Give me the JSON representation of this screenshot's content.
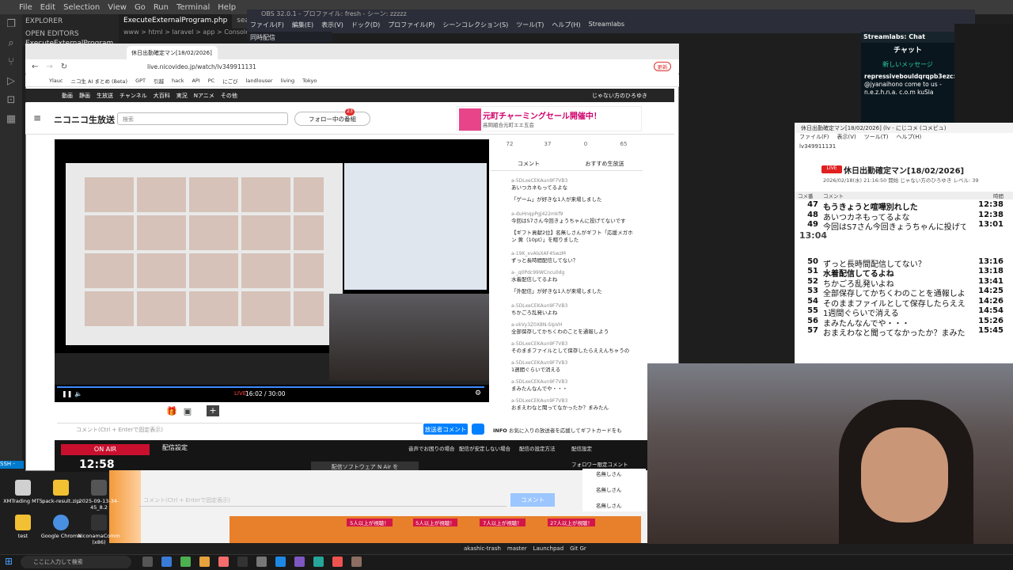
{
  "vscode": {
    "menu": [
      "File",
      "Edit",
      "Selection",
      "View",
      "Go",
      "Run",
      "Terminal",
      "Help"
    ],
    "explorer_label": "EXPLORER",
    "open_editors_label": "OPEN EDITORS",
    "open_file": "ExecuteExternalProgram.php",
    "tabs": [
      "ExecuteExternalProgram.php",
      "search_new"
    ],
    "breadcrumb": "www > html > laravel > app > Console > Commands",
    "status_left": "SSH -"
  },
  "obs": {
    "title": "OBS 32.0.1 - プロファイル: fresh - シーン: zzzzz",
    "menu": [
      "ファイル(F)",
      "編集(E)",
      "表示(V)",
      "ドック(D)",
      "プロファイル(P)",
      "シーンコレクション(S)",
      "ツール(T)",
      "ヘルプ(H)",
      "Streamlabs"
    ],
    "dock_tab": "同時配信"
  },
  "streamlabs": {
    "head": "Streamlabs: Chat",
    "chat_title": "チャット",
    "new_message": "新しいメッセージ",
    "user": "repressivebouldqrqpb3ezc:",
    "message": "@jyanaihono come to us - n.e.z.h.n.a. c.o.m kuSla"
  },
  "viewer": {
    "title": "休日出勤確定マン[18/02/2026] (lv - にじコメ  (コメビュ)",
    "menu": [
      "ファイル(F)",
      "表示(V)",
      "ツール(T)",
      "ヘルプ(H)"
    ],
    "url": "lv349911131",
    "live_badge": "LIVE",
    "program_title": "休日出勤確定マン[18/02/2026]",
    "program_sub": "2026/02/18(水) 21:16:50 開始  じゃない方のひろゆき  レベル: 39",
    "columns": [
      "コメ番",
      "コメント",
      "時間"
    ],
    "rows": [
      {
        "num": "47",
        "text": "もうきょうと喧嘩別れした",
        "time": "12:38",
        "style": "hi"
      },
      {
        "num": "48",
        "text": "あいつカネもってるよな",
        "time": "12:38",
        "style": ""
      },
      {
        "num": "49",
        "text": "今回はS7さん今回きょうちゃんに投げてない",
        "time": "13:01",
        "style": ""
      },
      {
        "num": "",
        "text": "【ギフト貢献2位】名無しさんがギフト「応援メガホン 黄（10pt）」を贈りました",
        "time": "13:04",
        "style": "gift"
      },
      {
        "num": "50",
        "text": "ずっと長時間配信してない？",
        "time": "13:16",
        "style": ""
      },
      {
        "num": "51",
        "text": "水着配信してるよね",
        "time": "13:18",
        "style": "hi"
      },
      {
        "num": "52",
        "text": "ちかごろ乱発いよね",
        "time": "13:41",
        "style": ""
      },
      {
        "num": "53",
        "text": "全部保存してかちくわのことを通報しよう",
        "time": "14:25",
        "style": ""
      },
      {
        "num": "54",
        "text": "そのままファイルとして保存したらええんちゃうの",
        "time": "14:26",
        "style": ""
      },
      {
        "num": "55",
        "text": "1週間ぐらいで消える",
        "time": "14:54",
        "style": ""
      },
      {
        "num": "56",
        "text": "まみたんなんでや・・・",
        "time": "15:26",
        "style": ""
      },
      {
        "num": "57",
        "text": "おまえわなと聞ってなかったか？まみたん",
        "time": "15:45",
        "style": ""
      }
    ]
  },
  "browser": {
    "tab_title": "休日出勤確定マン[18/02/2026]",
    "url": "live.nicovideo.jp/watch/lv349911131",
    "bookmarks": [
      "Ylauc",
      "ニコ生 AI まとめ (Beta)",
      "GPT",
      "引越",
      "hack",
      "API",
      "PC",
      "にごび",
      "landlouser",
      "living",
      "Tokyo"
    ],
    "update_btn": "更新"
  },
  "nico": {
    "topnav": [
      "動画",
      "静画",
      "生放送",
      "チャンネル",
      "大百科",
      "実況",
      "Nアニメ",
      "その他"
    ],
    "user": "じゃない方のひろゆき",
    "logo": "ニコニコ生放送",
    "search_placeholder": "検索",
    "follow_button": "フォロー中の番組",
    "follow_count": "23",
    "ad_title": "元町チャーミングセール開催中！",
    "ad_sub": "高岡組合元町エエ五会",
    "live_label": "LIVE",
    "time": "16:02 / 30:00",
    "stats": [
      "72",
      "37",
      "0",
      "65"
    ],
    "side_tabs": [
      "コメント",
      "おすすめ生放送"
    ],
    "comments": [
      {
        "uid": "a-5DLxeCEKAun9F7VB3",
        "text": "あいつカネもってるよな"
      },
      {
        "uid": "",
        "text": "「ゲーム」が好きな1人が来場しました"
      },
      {
        "uid": "a-duHnqpPgJ422mkf9",
        "text": "今回はS7さん今回きょうちゃんに投げてないです"
      },
      {
        "uid": "",
        "text": "【ギフト貢献2位】名無しさんがギフト「応援メガホン 黄（10pt）」を贈りました"
      },
      {
        "uid": "a-19K_xvAlsXAF4SwzM",
        "text": "ずっと長時間配信してない？"
      },
      {
        "uid": "a-_q0Pdc99WCncu0dg",
        "text": "水着配信してるよね"
      },
      {
        "uid": "",
        "text": "「外配信」が好きな1人が来場しました"
      },
      {
        "uid": "a-5DLxeCEKAun9F7VB3",
        "text": "ちかごろ乱発いよね"
      },
      {
        "uid": "a-vkVy3Z0X8N-SIpVH",
        "text": "全部保存してかちくわのことを通報しよう"
      },
      {
        "uid": "a-5DLxeCEKAun9F7VB3",
        "text": "そのままファイルとして保存したらええんちゃうの"
      },
      {
        "uid": "a-5DLxeCEKAun9F7VB3",
        "text": "1週間ぐらいで消える"
      },
      {
        "uid": "a-5DLxeCEKAun9F7VB3",
        "text": "まみたんなんでや・・・"
      },
      {
        "uid": "a-5DLxeCEKAun9F7VB3",
        "text": "おまえわなと聞ってなかったか？まみたん"
      }
    ],
    "comment_placeholder": "コメント(Ctrl + Enterで固定表示)",
    "comment_button": "放送者コメント",
    "info_label": "INFO",
    "info_text": "お気に入りの放送者を応援してギフトカードをも",
    "on_air": "ON AIR",
    "on_air_time": "12:58",
    "broadcast_settings": "配信設定",
    "bc_links": [
      "音声でお困りの場合",
      "配信が安定しない場合",
      "配信の設定方法"
    ],
    "bc_side_settings": "配信設定",
    "bc_follow_only": "フォロワー限定コメント",
    "software": "配信ソフトウェア N Air を"
  },
  "lower": {
    "comment_placeholder": "コメント(Ctrl + Enterで固定表示)",
    "comment_button": "コメント",
    "badges": [
      "5人以上が視聴！",
      "5人以上が視聴！",
      "7人以上が視聴！",
      "27人以上が視聴！"
    ],
    "names": [
      "名無しさん",
      "名無しさん",
      "名無しさん"
    ]
  },
  "desktop_icons": [
    {
      "label": "XMTrading MT5",
      "color": "#d0d0d0"
    },
    {
      "label": "pack-result.zip",
      "color": "#f2c033"
    },
    {
      "label": "2025-09-13-34-45_8.2",
      "color": "#555"
    },
    {
      "label": "test",
      "color": "#f2c033"
    },
    {
      "label": "Google Chrome",
      "color": "#4a90e2"
    },
    {
      "label": "NiconamaComm (x86)",
      "color": "#333"
    }
  ],
  "taskbar": {
    "search_placeholder": "ここに入力して検索",
    "git": [
      "akashic-trash",
      "master",
      "Launchpad",
      "Git Gr"
    ]
  }
}
